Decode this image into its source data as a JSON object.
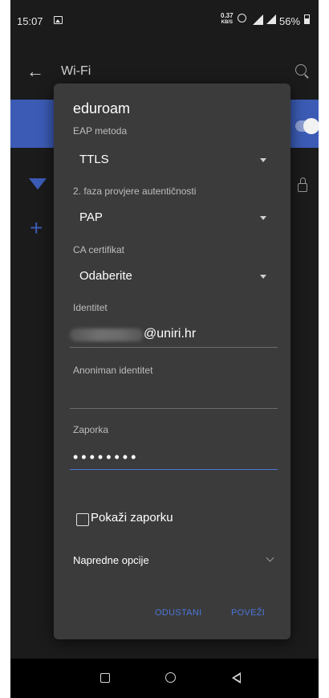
{
  "status_bar": {
    "time": "15:07",
    "speed_value": "0.37",
    "speed_unit": "KB/S",
    "battery": "56%"
  },
  "background": {
    "title": "Wi-Fi"
  },
  "dialog": {
    "title": "eduroam",
    "eap_label": "EAP metoda",
    "eap_value": "TTLS",
    "phase2_label": "2. faza provjere autentičnosti",
    "phase2_value": "PAP",
    "ca_label": "CA certifikat",
    "ca_value": "Odaberite",
    "identity_label": "Identitet",
    "identity_suffix": "@uniri.hr",
    "anon_label": "Anoniman identitet",
    "anon_value": "",
    "password_label": "Zaporka",
    "password_value": "••••••••",
    "show_password": "Pokaži zaporku",
    "advanced": "Napredne opcije",
    "cancel": "ODUSTANI",
    "connect": "POVEŽI"
  },
  "colors": {
    "accent": "#4b76d8",
    "dialog_bg": "#3b3b3b",
    "screen_bg": "#1b1b1b"
  }
}
